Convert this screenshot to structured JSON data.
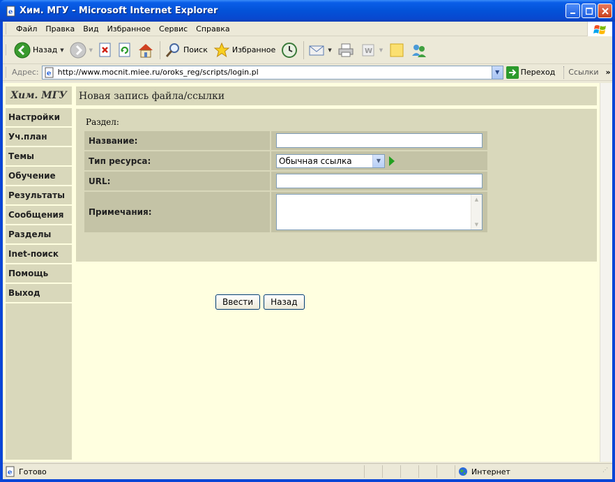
{
  "window": {
    "title": "Хим. МГУ - Microsoft Internet Explorer"
  },
  "menu": [
    "Файл",
    "Правка",
    "Вид",
    "Избранное",
    "Сервис",
    "Справка"
  ],
  "toolbar": {
    "back_label": "Назад",
    "search_label": "Поиск",
    "favorites_label": "Избранное"
  },
  "address": {
    "label": "Адрес:",
    "url": "http://www.mocnit.miee.ru/oroks_reg/scripts/login.pl",
    "go_label": "Переход",
    "links_label": "Ссылки"
  },
  "sidebar": {
    "title": "Хим. МГУ",
    "items": [
      "Настройки",
      "Уч.план",
      "Темы",
      "Обучение",
      "Результаты",
      "Сообщения",
      "Разделы",
      "Inet-поиск",
      "Помощь",
      "Выход"
    ]
  },
  "content": {
    "heading": "Новая запись файла/ссылки",
    "section_label": "Раздел:",
    "fields": {
      "name_label": "Название:",
      "type_label": "Тип ресурса:",
      "type_value": "Обычная ссылка",
      "url_label": "URL:",
      "notes_label": "Примечания:"
    },
    "buttons": {
      "submit": "Ввести",
      "back": "Назад"
    }
  },
  "status": {
    "text": "Готово",
    "zone": "Интернет"
  }
}
